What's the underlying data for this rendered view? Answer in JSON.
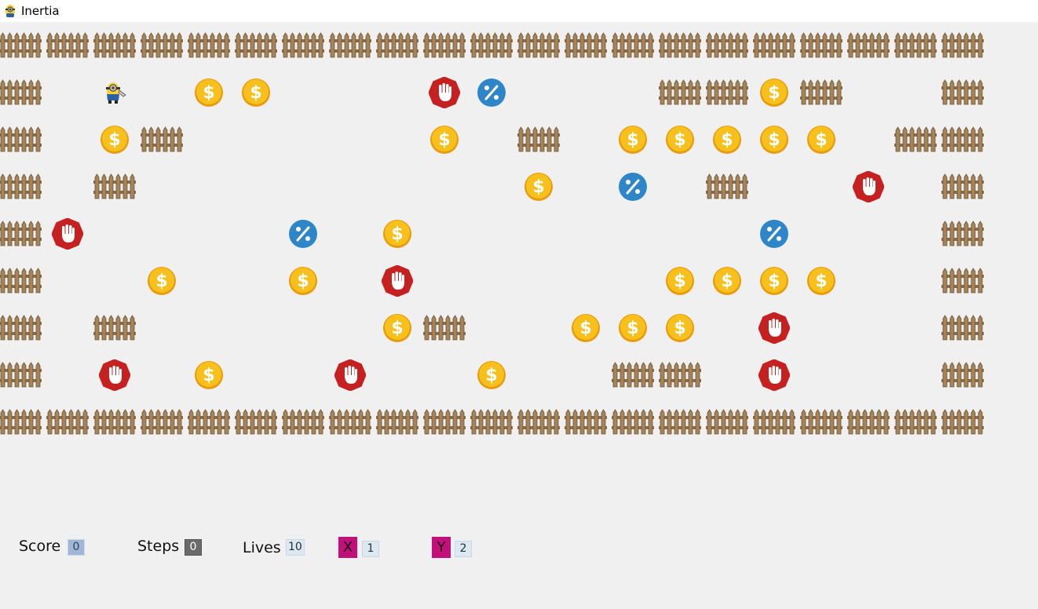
{
  "window": {
    "title": "Inertia",
    "icon": "minion-icon"
  },
  "board": {
    "cols": 21,
    "rows": 9,
    "legend": {
      "W": "fence-wall",
      "C": "gold-coin",
      "S": "stop-sign",
      "B": "bonus-percent",
      "P": "player-minion",
      ".": "empty"
    },
    "grid": [
      "WWWWWWWWWWWWWWWWWWWWW",
      "W.P.CC...SB...WWCW..W",
      "W.CW.....C.W.CCCCC.WW",
      "W.W........C.B.W..S.W",
      "WS....B.C.......B...W",
      "W..C..C.S.....CCCC..W",
      "W.W.....CW..CCC.S...W",
      "W.S.C..S..C..WW.S...W",
      "WWWWWWWWWWWWWWWWWWWWW"
    ]
  },
  "colors": {
    "coin": "#f7c01c",
    "coin_rim": "#e89c0b",
    "stop": "#c62121",
    "bonus": "#2e86c8",
    "fence": "#8a6c4a",
    "axis_tag": "#c2107a"
  },
  "hud": {
    "score_label": "Score",
    "score_value": "0",
    "steps_label": "Steps",
    "steps_value": "0",
    "lives_label": "Lives",
    "lives_value": "10",
    "x_label": "X",
    "x_value": "1",
    "y_label": "Y",
    "y_value": "2"
  }
}
